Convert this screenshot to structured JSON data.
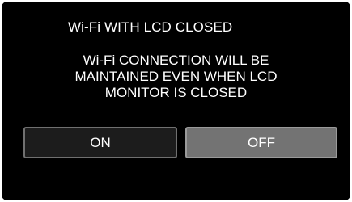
{
  "dialog": {
    "title": "Wi-Fi WITH LCD CLOSED",
    "message_lines": [
      "Wi-Fi CONNECTION WILL BE",
      "MAINTAINED EVEN WHEN LCD",
      "MONITOR IS CLOSED"
    ]
  },
  "buttons": {
    "on_label": "ON",
    "off_label": "OFF",
    "selected": "OFF"
  },
  "colors": {
    "screen_background": "#000000",
    "text": "#ffffff",
    "on_button_background": "#1c1c1c",
    "off_button_background_selected": "#737373"
  }
}
